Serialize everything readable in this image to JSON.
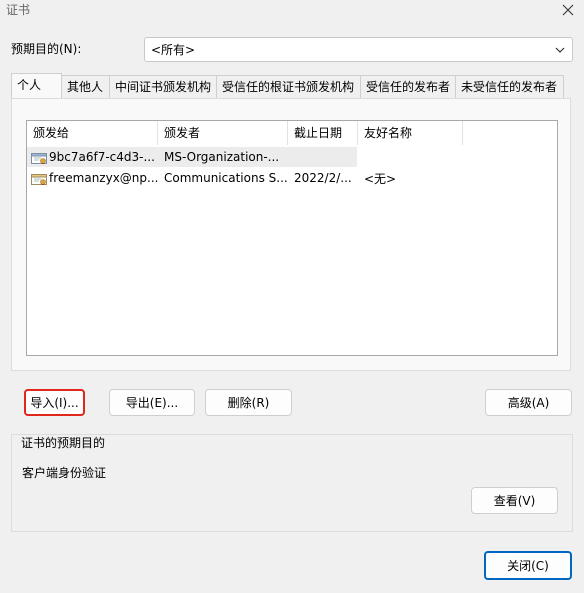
{
  "window": {
    "title": "证书"
  },
  "purpose": {
    "label": "预期目的(N):",
    "value": "<所有>"
  },
  "tabs": [
    {
      "label": "个人"
    },
    {
      "label": "其他人"
    },
    {
      "label": "中间证书颁发机构"
    },
    {
      "label": "受信任的根证书颁发机构"
    },
    {
      "label": "受信任的发布者"
    },
    {
      "label": "未受信任的发布者"
    }
  ],
  "table": {
    "columns": [
      "颁发给",
      "颁发者",
      "截止日期",
      "友好名称"
    ],
    "rows": [
      {
        "issued_to": "9bc7a6f7-c4d3-...",
        "issued_by": "MS-Organization-...",
        "expiry": "",
        "friendly_name": ""
      },
      {
        "issued_to": "freemanzyx@np...",
        "issued_by": "Communications S...",
        "expiry": "2022/2/...",
        "friendly_name": "<无>"
      }
    ]
  },
  "buttons": {
    "import": "导入(I)...",
    "export": "导出(E)...",
    "remove": "删除(R)",
    "advanced": "高级(A)",
    "view": "查看(V)",
    "close": "关闭(C)"
  },
  "cert_purposes": {
    "title": "证书的预期目的",
    "text": "客户端身份验证"
  },
  "colors": {
    "focus_outline": "#e1261c",
    "default_button_border": "#0067c0"
  }
}
